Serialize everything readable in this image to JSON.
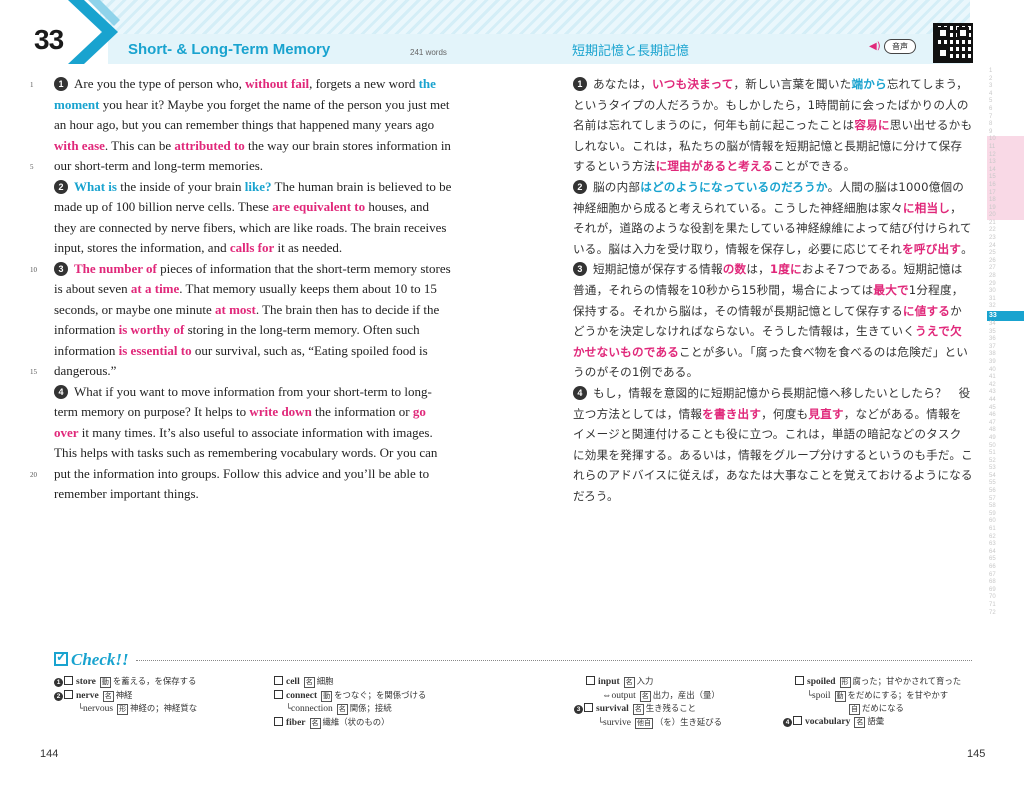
{
  "header": {
    "unit_number": "33",
    "english_title": "Short- & Long-Term Memory",
    "word_count": "241 words",
    "japanese_title": "短期記憶と長期記憶",
    "audio_icon": "speaker-icon",
    "audio_label": "音声",
    "qr_icon": "qr-code-icon"
  },
  "english": {
    "line_numbers": [
      "1",
      "5",
      "10",
      "15",
      "20"
    ],
    "p1": {
      "num": "1",
      "t1": "Are you the type of person who, ",
      "h1": "without fail",
      "t2": ", forgets a new word ",
      "h2": "the moment",
      "t3": " you hear it?  Maybe you forget the name of the person you just met an hour ago, but you can remember things that happened many years ago ",
      "h3": "with ease",
      "t4": ".  This can be ",
      "h4": "attributed to",
      "t5": " the way our brain stores information in our short-term and long-term memories."
    },
    "p2": {
      "num": "2",
      "h1": "What is",
      "t1": " the inside of your brain ",
      "h2": "like?",
      "t2": "  The human brain is believed to be made up of 100 billion nerve cells.  These ",
      "h3": "are equivalent to",
      "t3": " houses, and they are connected by nerve fibers, which are like roads.  The brain receives input, stores the information, and ",
      "h4": "calls for",
      "t4": " it as needed."
    },
    "p3": {
      "num": "3",
      "h1": "The number of",
      "t1": " pieces of information that the short-term memory stores is about seven ",
      "h2": "at a time",
      "t2": ".  That memory usually keeps them about 10 to 15 seconds, or maybe one minute ",
      "h3": "at most",
      "t3": ".  The brain then has to decide if the information ",
      "h4": "is worthy of",
      "t4": " storing in the long-term memory.  Often such information ",
      "h5": "is essential to",
      "t5": " our survival, such as, “Eating spoiled food is dangerous.”"
    },
    "p4": {
      "num": "4",
      "t1": "What if you want to move information from your short-term to long-term memory on purpose?  It helps to ",
      "h1": "write down",
      "t2": " the information or ",
      "h2": "go over",
      "t3": " it many times.  It’s also useful to associate information with images.  This helps with tasks such as remembering vocabulary words.  Or you can put the information into groups.  Follow this advice and you’ll be able to remember important things."
    }
  },
  "japanese": {
    "p1": {
      "num": "1",
      "t1": "あなたは，",
      "h1": "いつも決まって",
      "t2": "，新しい言葉を聞いた",
      "h2": "端から",
      "t3": "忘れてしまう，というタイプの人だろうか。もしかしたら，1時間前に会ったばかりの人の名前は忘れてしまうのに，何年も前に起こったことは",
      "h3": "容易に",
      "t4": "思い出せるかもしれない。これは，私たちの脳が情報を短期記憶と長期記憶に分けて保存するという方法",
      "h4": "に理由があると考える",
      "t5": "ことができる。"
    },
    "p2": {
      "num": "2",
      "t1": "脳の内部",
      "h1": "はどのようになっているのだろうか",
      "t2": "。人間の脳は1000億個の神経細胞から成ると考えられている。こうした神経細胞は家々",
      "h2": "に相当し",
      "t3": "，それが，道路のような役割を果たしている神経線維によって結び付けられている。脳は入力を受け取り，情報を保存し，必要に応じてそれ",
      "h3": "を呼び出す",
      "t4": "。"
    },
    "p3": {
      "num": "3",
      "t1": "短期記憶が保存する情報",
      "h1": "の数",
      "t2": "は，",
      "h2": "1度に",
      "t3": "およそ7つである。短期記憶は普通，それらの情報を10秒から15秒間，場合によっては",
      "h3": "最大で",
      "t4": "1分程度，保持する。それから脳は，その情報が長期記憶として保存する",
      "h4": "に値する",
      "t5": "かどうかを決定しなければならない。そうした情報は，生きていく",
      "h5": "うえで欠かせないものである",
      "t6": "ことが多い。「腐った食べ物を食べるのは危険だ」というのがその1例である。"
    },
    "p4": {
      "num": "4",
      "t1": "もし，情報を意図的に短期記憶から長期記憶へ移したいとしたら？　役立つ方法としては，情報",
      "h1": "を書き出す",
      "t2": "，何度も",
      "h2": "見直す",
      "t3": "，などがある。情報をイメージと関連付けることも役に立つ。これは，単語の暗記などのタスクに効果を発揮する。あるいは，情報をグループ分けするというのも手だ。これらのアドバイスに従えば，あなたは大事なことを覚えておけるようになるだろう。"
    }
  },
  "index": {
    "numbers": [
      "1",
      "2",
      "3",
      "4",
      "5",
      "6",
      "7",
      "8",
      "9",
      "10",
      "11",
      "12",
      "13",
      "14",
      "15",
      "16",
      "17",
      "18",
      "19",
      "20",
      "21",
      "22",
      "23",
      "24",
      "25",
      "26",
      "27",
      "28",
      "29",
      "30",
      "31",
      "32",
      "33",
      "34",
      "35",
      "36",
      "37",
      "38",
      "39",
      "40",
      "41",
      "42",
      "43",
      "44",
      "45",
      "46",
      "47",
      "48",
      "49",
      "50",
      "51",
      "52",
      "53",
      "54",
      "55",
      "56",
      "57",
      "58",
      "59",
      "60",
      "61",
      "62",
      "63",
      "64",
      "65",
      "66",
      "67",
      "68",
      "69",
      "70",
      "71",
      "72"
    ],
    "current": "33"
  },
  "check": {
    "title": "Check!!",
    "check_icon": "checkbox-check-icon",
    "col1": [
      {
        "num": "1",
        "word": "store",
        "pos": "動",
        "meaning": "を蓄える，を保存する"
      },
      {
        "num": "2",
        "word": "nerve",
        "pos": "名",
        "meaning": "神経"
      },
      {
        "sub": "nervous",
        "pos": "形",
        "meaning": "神経の；神経質な"
      }
    ],
    "col2": [
      {
        "word": "cell",
        "pos": "名",
        "meaning": "細胞"
      },
      {
        "word": "connect",
        "pos": "動",
        "meaning": "をつなぐ；を関係づける"
      },
      {
        "sub": "connection",
        "pos": "名",
        "meaning": "関係；接続"
      },
      {
        "word": "fiber",
        "pos": "名",
        "meaning": "繊維（状のもの）"
      }
    ],
    "col3": [
      {
        "word": "input",
        "pos": "名",
        "meaning": "入力"
      },
      {
        "arrow": "⇔output",
        "pos": "名",
        "meaning": "出力，産出（量）"
      },
      {
        "num": "3",
        "word": "survival",
        "pos": "名",
        "meaning": "生き残ること"
      },
      {
        "sub": "survive",
        "pos": "他自",
        "meaning": "（を）生き延びる"
      }
    ],
    "col4": [
      {
        "word": "spoiled",
        "pos": "形",
        "meaning": "腐った；甘やかされて育った"
      },
      {
        "sub": "spoil",
        "pos": "動",
        "meaning": "をだめにする；を甘やかす"
      },
      {
        "pos": "自",
        "meaning": "だめになる"
      },
      {
        "num": "4",
        "word": "vocabulary",
        "pos": "名",
        "meaning": "語彙"
      }
    ]
  },
  "pages": {
    "left": "144",
    "right": "145"
  }
}
